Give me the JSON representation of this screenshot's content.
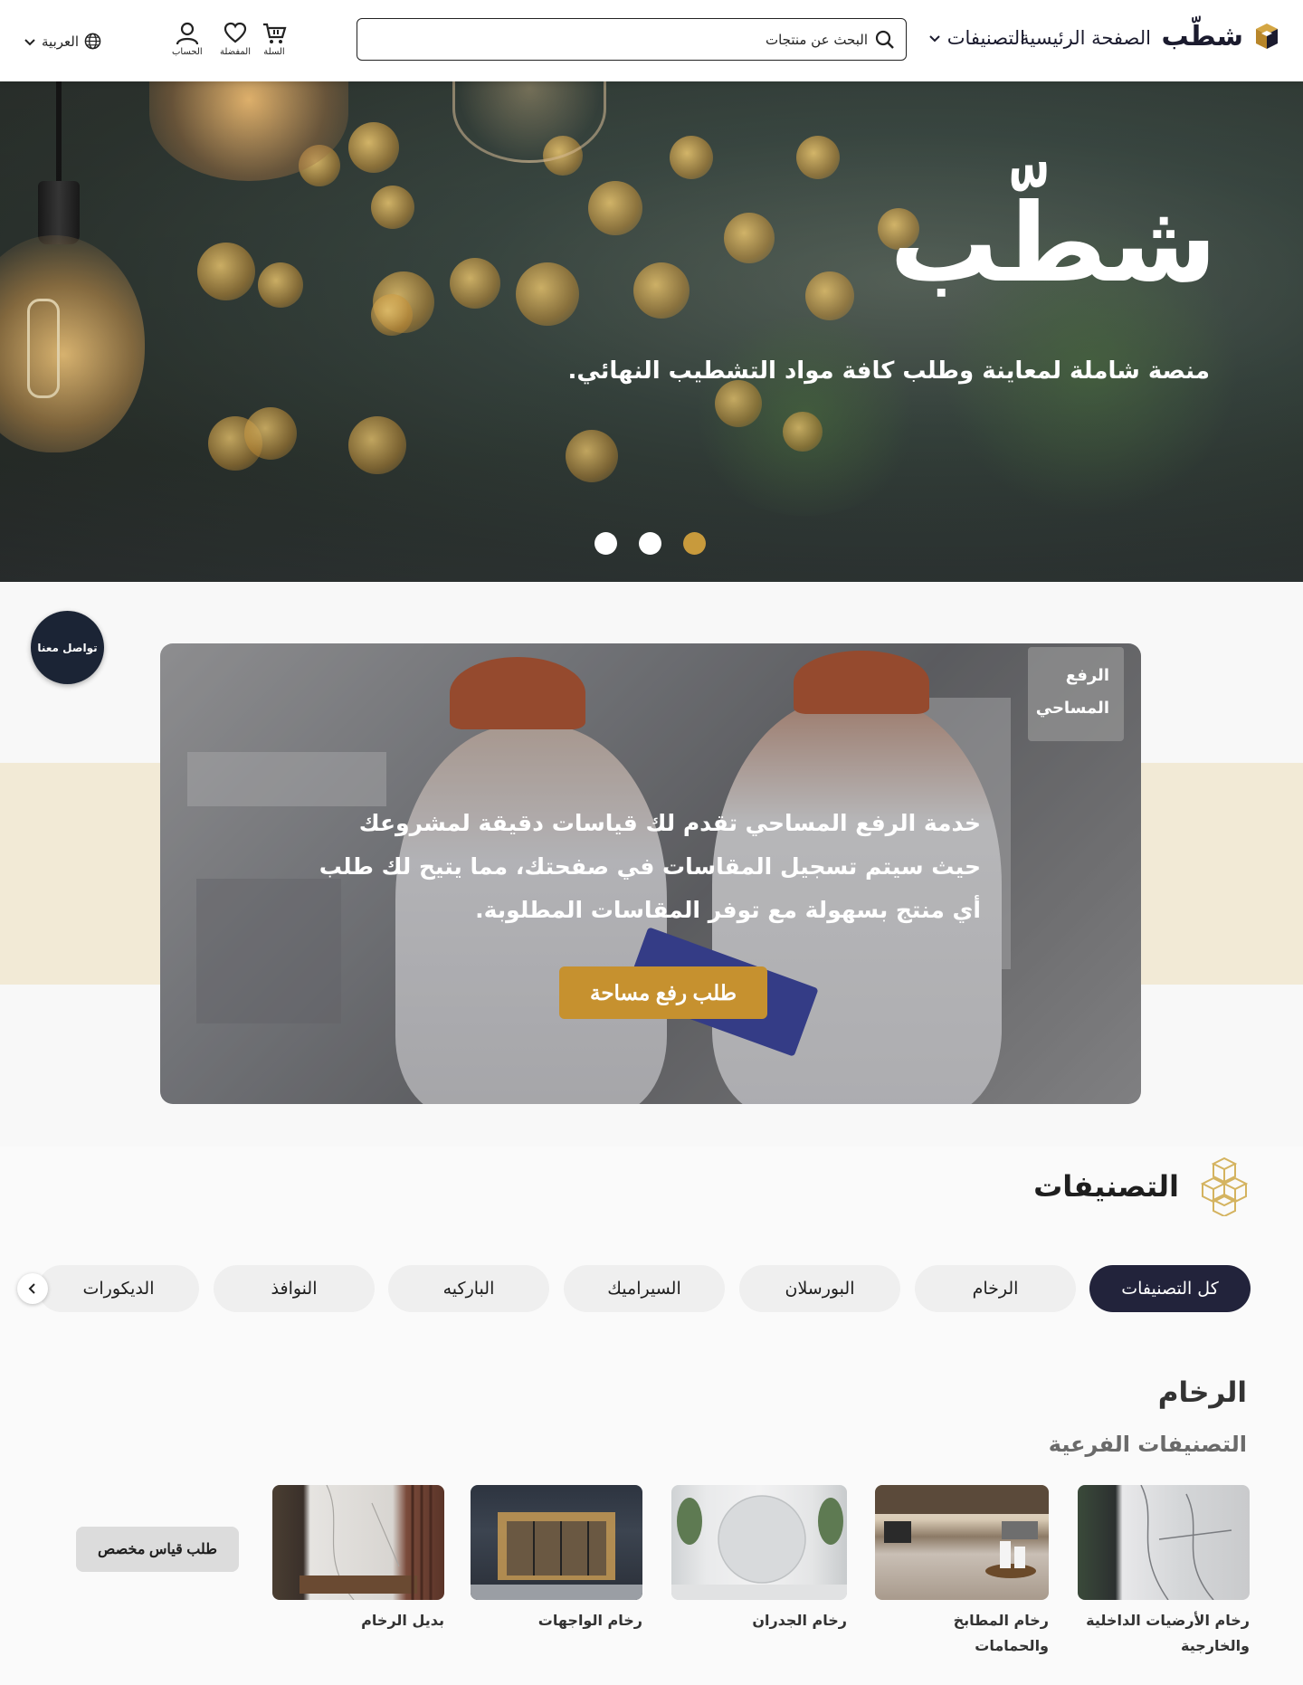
{
  "header": {
    "logo_text": "شطّب",
    "nav_home": "الصفحة الرئيسية",
    "nav_categories": "التصنيفات",
    "search_placeholder": "البحث عن منتجات",
    "cart_label": "السلة",
    "favorites_label": "المفضلة",
    "account_label": "الحساب",
    "language": "العربية"
  },
  "hero": {
    "title": "شطّب",
    "subtitle": "منصة شاملة لمعاينة وطلب كافة مواد التشطيب النهائي.",
    "slide_count": 3,
    "active_slide": 3
  },
  "contact": {
    "label": "تواصل معنا"
  },
  "survey": {
    "tag": "الرفع المساحي",
    "description": "خدمة الرفع المساحي تقدم لك قياسات دقيقة لمشروعك حيث سيتم تسجيل المقاسات في صفحتك، مما يتيح لك طلب أي منتج بسهولة مع توفر المقاسات المطلوبة.",
    "button": "طلب رفع مساحة"
  },
  "categories": {
    "title": "التصنيفات",
    "pills": [
      "كل التصنيفات",
      "الرخام",
      "البورسلان",
      "السيراميك",
      "الباركيه",
      "النوافذ",
      "الديكورات"
    ],
    "active_index": 0
  },
  "section": {
    "heading": "الرخام",
    "subheading": "التصنيفات الفرعية",
    "subcategories": [
      "رخام الأرضيات الداخلية والخارجية",
      "رخام المطابخ والحمامات",
      "رخام الجدران",
      "رخام الواجهات",
      "بديل الرخام"
    ],
    "custom_button": "طلب قياس مخصص"
  },
  "colors": {
    "accent": "#c6912f",
    "dark_navy": "#22233b",
    "beige_band": "#f2ead6",
    "contact_bg": "#1b2435"
  }
}
